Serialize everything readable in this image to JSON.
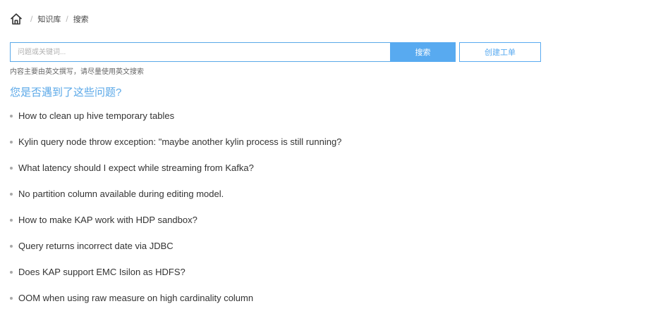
{
  "breadcrumb": {
    "home_icon": "home-icon",
    "separator": "/",
    "items": [
      "知识库",
      "搜索"
    ]
  },
  "search": {
    "placeholder": "问题或关键词...",
    "value": "",
    "button_label": "搜索",
    "create_ticket_label": "创建工单",
    "hint": "内容主要由英文撰写，请尽量使用英文搜索"
  },
  "faq": {
    "title": "您是否遇到了这些问题?",
    "items": [
      "How to clean up hive temporary tables",
      "Kylin query node throw exception: \"maybe another kylin process is still running?",
      "What latency should I expect while streaming from Kafka?",
      "No partition column available during editing model.",
      "How to make KAP work with HDP sandbox?",
      "Query returns incorrect date via JDBC",
      "Does KAP support EMC Isilon as HDFS?",
      "OOM when using raw measure on high cardinality column"
    ]
  },
  "colors": {
    "accent": "#58aaf0",
    "text": "#333333",
    "muted": "#666666"
  }
}
